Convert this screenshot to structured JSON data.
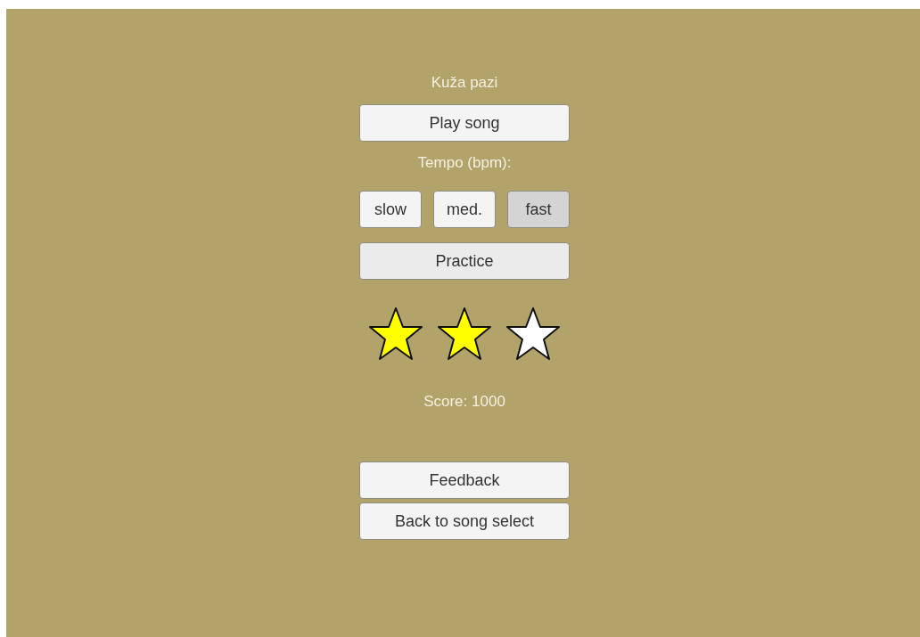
{
  "title": "Kuža pazi",
  "play_button": "Play song",
  "tempo_label": "Tempo (bpm):",
  "tempo_options": [
    {
      "label": "slow",
      "selected": false
    },
    {
      "label": "med.",
      "selected": false
    },
    {
      "label": "fast",
      "selected": true
    }
  ],
  "practice_button": "Practice",
  "rating": {
    "stars": 2
  },
  "score": "Score: 1000",
  "buttons": [
    "Feedback",
    "Back to song select"
  ]
}
